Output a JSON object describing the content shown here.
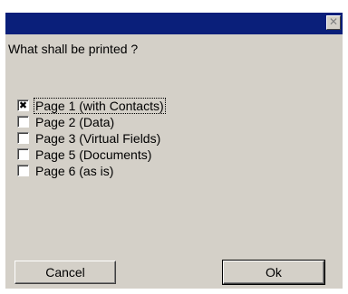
{
  "dialog": {
    "title": "",
    "close_glyph": "✕",
    "prompt": "What shall be printed ?",
    "options": [
      {
        "label": "Page 1 (with Contacts)",
        "checked": true,
        "mark": "✖"
      },
      {
        "label": "Page 2 (Data)",
        "checked": false,
        "mark": ""
      },
      {
        "label": "Page 3 (Virtual Fields)",
        "checked": false,
        "mark": ""
      },
      {
        "label": "Page 5 (Documents)",
        "checked": false,
        "mark": ""
      },
      {
        "label": "Page 6 (as is)",
        "checked": false,
        "mark": ""
      }
    ],
    "buttons": {
      "cancel": "Cancel",
      "ok": "Ok"
    }
  },
  "colors": {
    "titlebar": "#0a1f7a",
    "face": "#d4d0c8"
  }
}
